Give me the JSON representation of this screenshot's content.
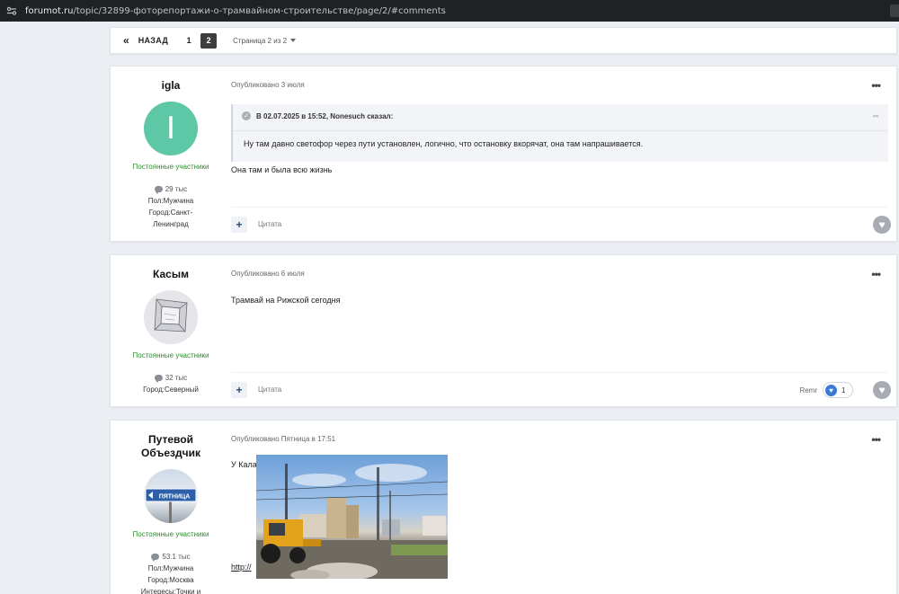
{
  "browser": {
    "host": "forumot.ru",
    "path": "/topic/32899-фоторепортажи-о-трамвайном-строительстве/page/2/#comments"
  },
  "pagination": {
    "prev_label": "НАЗАД",
    "pages": [
      "1",
      "2"
    ],
    "page_info": "Страница 2 из 2"
  },
  "posts": [
    {
      "author": "igla",
      "avatar_letter": "I",
      "avatar_color": "#5ec7a6",
      "role": "Постоянные участники",
      "count": "29 тыс",
      "info": [
        "Пол:Мужчина",
        "Город:Санкт-",
        "Ленинград"
      ],
      "posted": "Опубликовано 3 июля",
      "quote_header": "В 02.07.2025 в 15:52, Nonesuch сказал:",
      "quote_text": "Ну там давно светофор через пути установлен, логично, что остановку вкорячат, она там напрашивается.",
      "text": "Она там и была всю жизнь",
      "cite_label": "Цитата"
    },
    {
      "author": "Касым",
      "role": "Постоянные участники",
      "count": "32 тыс",
      "info": [
        "Город:Северный"
      ],
      "posted": "Опубликовано 6 июля",
      "text": "Трамвай на Рижской сегодня",
      "cite_label": "Цитата",
      "reactor": "Remr",
      "reaction_count": "1"
    },
    {
      "author_line1": "Путевой",
      "author_line2": "Объездчик",
      "avatar_sign_text": "ПЯТНИЦА",
      "role": "Постоянные участники",
      "count": "53.1 тыс",
      "info": [
        "Пол:Мужчина",
        "Город:Москва",
        "Интересы:Точки и"
      ],
      "posted": "Опубликовано Пятница в 17:51",
      "text": "У Каланчёвки уже начали разбирать пути:",
      "link_text": "http://"
    }
  ]
}
